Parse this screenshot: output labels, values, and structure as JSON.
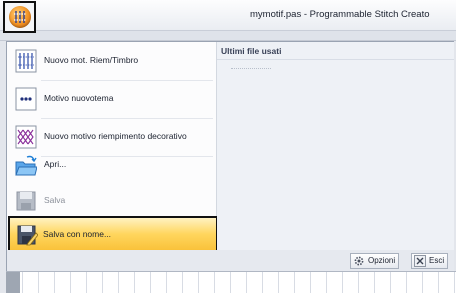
{
  "window": {
    "title": "mymotif.pas - Programmable Stitch Creato"
  },
  "app_menu": {
    "items": [
      {
        "label": "Nuovo mot. Riem/Timbro",
        "icon": "new-fill-stamp-icon"
      },
      {
        "label": "Motivo nuovotema",
        "icon": "new-motif-icon"
      },
      {
        "label": "Nuovo motivo riempimento decorativo",
        "icon": "new-decorative-fill-icon"
      },
      {
        "label": "Apri...",
        "icon": "open-folder-icon"
      },
      {
        "label": "Salva",
        "icon": "save-icon",
        "disabled": true
      },
      {
        "label": "Salva con nome...",
        "icon": "save-as-icon",
        "selected": true
      }
    ],
    "recent": {
      "header": "Ultimi file usati"
    },
    "buttons": {
      "options": "Opzioni",
      "exit": "Esci"
    }
  },
  "colors": {
    "highlight": "#ffd65e",
    "orb": "#f29122",
    "frame": "#111111"
  }
}
